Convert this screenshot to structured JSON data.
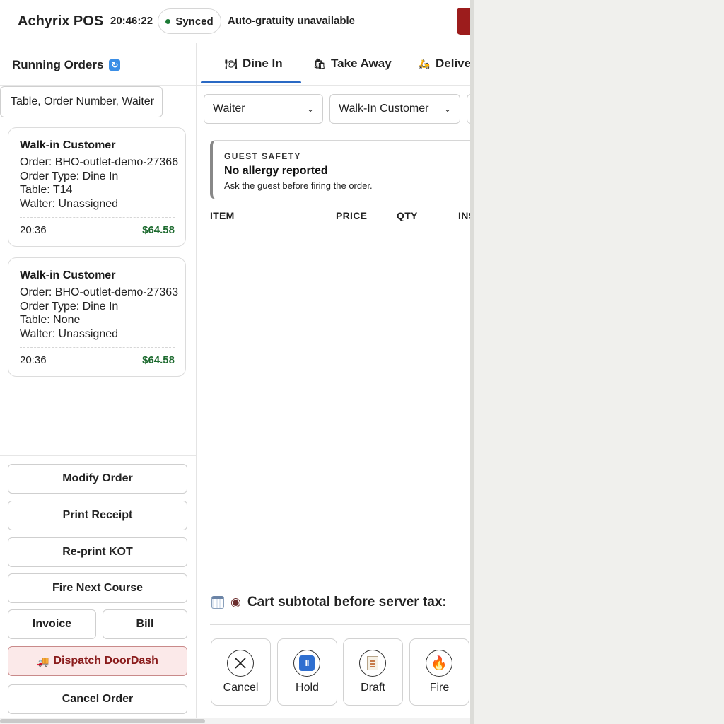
{
  "header": {
    "brand": "Achyrix POS",
    "clock": "20:46:22",
    "sync_status": "Synced",
    "gratuity_notice": "Auto-gratuity unavailable"
  },
  "sidebar": {
    "title": "Running Orders",
    "search_placeholder": "Table, Order Number, Waiter",
    "orders": [
      {
        "customer": "Walk-in Customer",
        "order": "Order: BHO-outlet-demo-27366",
        "type": "Order Type: Dine In",
        "table": "Table: T14",
        "waiter": "Walter: Unassigned",
        "time": "20:36",
        "total": "$64.58"
      },
      {
        "customer": "Walk-in Customer",
        "order": "Order: BHO-outlet-demo-27363",
        "type": "Order Type: Dine In",
        "table": "Table: None",
        "waiter": "Walter: Unassigned",
        "time": "20:36",
        "total": "$64.58"
      }
    ],
    "actions": {
      "modify": "Modify Order",
      "print_receipt": "Print Receipt",
      "reprint_kot": "Re-print KOT",
      "fire_next": "Fire Next Course",
      "invoice": "Invoice",
      "bill": "Bill",
      "dispatch": "Dispatch DoorDash",
      "cancel": "Cancel Order"
    }
  },
  "main": {
    "tabs": [
      {
        "label": "Dine In",
        "icon": "plate-icon"
      },
      {
        "label": "Take Away",
        "icon": "bag-icon"
      },
      {
        "label": "Delivery",
        "icon": "scooter-icon"
      }
    ],
    "active_tab": "Dine In",
    "waiter_select": "Waiter",
    "customer_select": "Walk-In Customer",
    "guest_safety": {
      "kicker": "GUEST SAFETY",
      "title": "No allergy reported",
      "subtitle": "Ask the guest before firing the order."
    },
    "columns": [
      "ITEM",
      "PRICE",
      "QTY",
      "INSTRUCTIONS"
    ],
    "subtotal_label": "Cart subtotal before server tax:",
    "tiles": {
      "cancel": "Cancel",
      "hold": "Hold",
      "draft": "Draft",
      "fire": "Fire"
    }
  },
  "colors": {
    "accent_blue": "#2a69c4",
    "synced_green": "#1b7a35",
    "total_green": "#1d6a2f",
    "danger_red": "#9c1c1c",
    "dispatch_bg": "#fbe9e9"
  }
}
